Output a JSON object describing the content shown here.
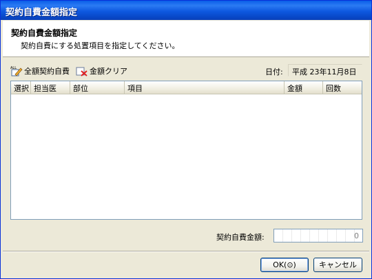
{
  "window": {
    "title": "契約自費金額指定"
  },
  "header": {
    "title": "契約自費金額指定",
    "description": "契約自費にする処置項目を指定してください。"
  },
  "toolbar": {
    "all_contract_label": "全額契約自費",
    "all_icon_text": "ALL",
    "clear_label": "金額クリア",
    "date_label": "日付:",
    "date_value": "平成 23年11月8日"
  },
  "grid": {
    "columns": [
      "選択",
      "担当医",
      "部位",
      "項目",
      "金額",
      "回数"
    ],
    "rows": []
  },
  "total": {
    "label": "契約自費金額:",
    "value": "0"
  },
  "buttons": {
    "ok": "OK(⊙)",
    "cancel": "キャンセル"
  },
  "colors": {
    "title_bar": "#0a5de8",
    "window_bg": "#ece9d8",
    "grid_border": "#7f9db9"
  }
}
